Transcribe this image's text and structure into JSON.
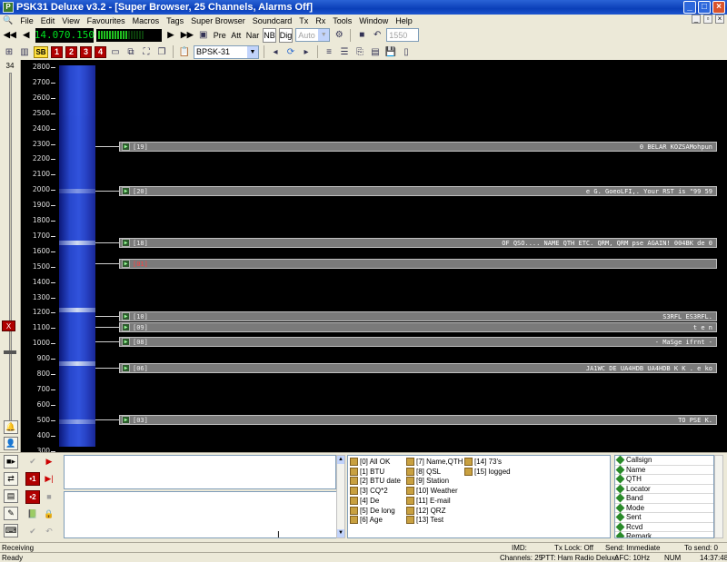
{
  "window": {
    "title": "PSK31 Deluxe v3.2 - [Super Browser, 25 Channels, Alarms Off]"
  },
  "menu": [
    "File",
    "Edit",
    "View",
    "Favourites",
    "Macros",
    "Tags",
    "Super Browser",
    "Soundcard",
    "Tx",
    "Rx",
    "Tools",
    "Window",
    "Help"
  ],
  "toolbar": {
    "frequency": "14.070.150",
    "pre": "Pre",
    "att": "Att",
    "nar": "Nar",
    "nb": "NB",
    "dig": "Dig",
    "auto": "Auto",
    "audio_freq": "1550",
    "sb": "SB",
    "presets": [
      "1",
      "2",
      "3",
      "4"
    ],
    "mode": "BPSK-31",
    "meter_on": 11,
    "meter_total": 17
  },
  "waterfall": {
    "level": "34",
    "scale": [
      "2800",
      "2700",
      "2600",
      "2500",
      "2400",
      "2300",
      "2200",
      "2100",
      "2000",
      "1900",
      "1800",
      "1700",
      "1600",
      "1500",
      "1400",
      "1300",
      "1200",
      "1100",
      "1000",
      "900",
      "800",
      "700",
      "600",
      "500",
      "400",
      "300"
    ],
    "alarm_label": "X",
    "channels": [
      {
        "id": "[19]",
        "text": "0 BELAR KOZSAMohpun",
        "selected": false
      },
      {
        "id": "[20]",
        "text": "e G. GoeoLFI,. Your RST is \"99 59",
        "selected": false
      },
      {
        "id": "[18]",
        "text": "OF QSO.... NAME QTH ETC. QRM, QRM pse AGAIN! 004BK de 0",
        "selected": false
      },
      {
        "id": "[01]",
        "text": "",
        "selected": true
      },
      {
        "id": "[10]",
        "text": "S3RFL ES3RFL.",
        "selected": false
      },
      {
        "id": "[09]",
        "text": "t e n",
        "selected": false
      },
      {
        "id": "[08]",
        "text": "- MaSge ifrnt -",
        "selected": false
      },
      {
        "id": "[06]",
        "text": "JA1WC DE UA4HDB UA4HDB K K . e ko",
        "selected": false
      },
      {
        "id": "[03]",
        "text": "TO PSE K.",
        "selected": false
      }
    ]
  },
  "macros": [
    [
      "[0] All OK",
      "[1] BTU",
      "[2] BTU date",
      "[3] CQ*2",
      "[4] De",
      "[5] De long",
      "[6] Age"
    ],
    [
      "[7] Name,QTH",
      "[8] QSL",
      "[9] Station",
      "[10] Weather",
      "[11] E-mail",
      "[12] QRZ",
      "[13] Test"
    ],
    [
      "[14] 73's",
      "[15] logged"
    ]
  ],
  "log_fields": [
    "Callsign",
    "Name",
    "QTH",
    "Locator",
    "Band",
    "Mode",
    "Sent",
    "Rcvd",
    "Remark"
  ],
  "status": {
    "receiving": "Receiving",
    "imd": "IMD:",
    "txlock": "Tx Lock: Off",
    "send": "Send: Immediate",
    "tosend": "To send: 0",
    "ready": "Ready",
    "channels": "Channels: 25",
    "ptt": "PTT: Ham Radio Deluxe",
    "afc": "AFC: 10Hz",
    "num": "NUM",
    "time": "14:37:48"
  }
}
